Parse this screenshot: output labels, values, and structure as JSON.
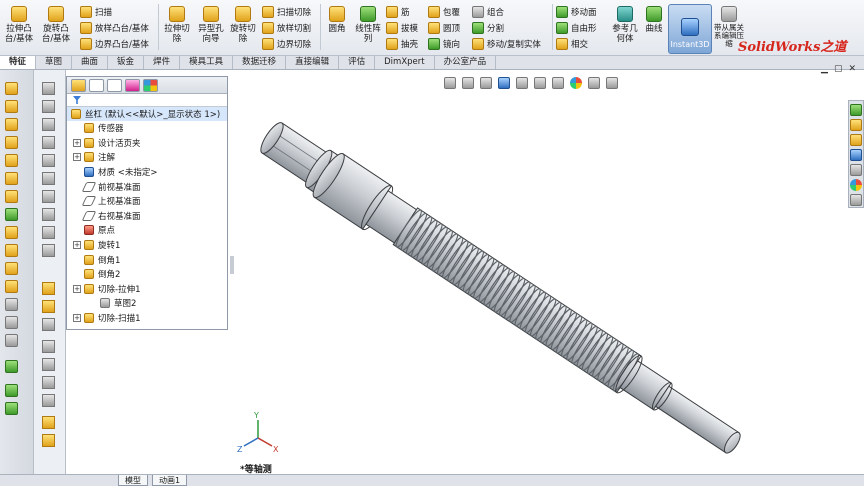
{
  "ribbon": {
    "features": [
      {
        "label": "拉伸凸台/基体",
        "icon": "extrude-boss-icon"
      },
      {
        "label": "旋转凸台/基体",
        "icon": "revolve-boss-icon"
      }
    ],
    "sweeps": [
      {
        "label": "扫描",
        "icon": "sweep-icon"
      },
      {
        "label": "放样凸台/基体",
        "icon": "loft-icon"
      },
      {
        "label": "边界凸台/基体",
        "icon": "boundary-boss-icon"
      }
    ],
    "cuts": [
      {
        "label": "拉伸切除",
        "icon": "extrude-cut-icon"
      },
      {
        "label": "异型孔向导",
        "icon": "hole-wizard-icon"
      },
      {
        "label": "旋转切除",
        "icon": "revolve-cut-icon"
      }
    ],
    "cut_small": [
      {
        "label": "扫描切除",
        "icon": "sweep-cut-icon"
      },
      {
        "label": "放样切割",
        "icon": "loft-cut-icon"
      },
      {
        "label": "边界切除",
        "icon": "boundary-cut-icon"
      }
    ],
    "fillet": {
      "label": "圆角",
      "icon": "fillet-icon"
    },
    "pattern": {
      "label": "线性阵列",
      "icon": "linear-pattern-icon"
    },
    "col_a": [
      {
        "label": "筋",
        "icon": "rib-icon"
      },
      {
        "label": "拔模",
        "icon": "draft-icon"
      },
      {
        "label": "抽壳",
        "icon": "shell-icon"
      }
    ],
    "col_b": [
      {
        "label": "包覆",
        "icon": "wrap-icon"
      },
      {
        "label": "圆顶",
        "icon": "dome-icon"
      },
      {
        "label": "镜向",
        "icon": "mirror-icon"
      }
    ],
    "col_c": [
      {
        "label": "组合",
        "icon": "combine-icon"
      },
      {
        "label": "分割",
        "icon": "split-icon"
      },
      {
        "label": "移动/复制实体",
        "icon": "move-copy-icon"
      }
    ],
    "col_d": [
      {
        "label": "移动面",
        "icon": "move-face-icon"
      },
      {
        "label": "自由形",
        "icon": "freeform-icon"
      },
      {
        "label": "相交",
        "icon": "intersect-icon"
      }
    ],
    "refgeo": {
      "label": "参考几何体",
      "icon": "reference-geometry-icon"
    },
    "curves": {
      "label": "曲线",
      "icon": "curves-icon"
    },
    "instant3d": {
      "label": "Instant3D",
      "icon": "instant3d-icon"
    },
    "assembly": {
      "label": "带从属关系编辑压缩",
      "icon": "assembly-icon"
    },
    "brand": "SolidWorks之道"
  },
  "tabs": [
    "特征",
    "草图",
    "曲面",
    "钣金",
    "焊件",
    "模具工具",
    "数据迁移",
    "直接编辑",
    "评估",
    "DimXpert",
    "办公室产品"
  ],
  "tree": {
    "root": "丝杠 (默认<<默认>_显示状态 1>)",
    "nodes": [
      {
        "label": "传感器",
        "exp": false,
        "indent": 0,
        "icon": "sensor-icon"
      },
      {
        "label": "设计活页夹",
        "exp": true,
        "indent": 0,
        "icon": "design-binder-icon"
      },
      {
        "label": "注解",
        "exp": true,
        "indent": 0,
        "icon": "annotations-icon"
      },
      {
        "label": "材质 <未指定>",
        "exp": false,
        "indent": 0,
        "icon": "material-icon"
      },
      {
        "label": "前视基准面",
        "exp": false,
        "indent": 0,
        "icon": "plane-icon"
      },
      {
        "label": "上视基准面",
        "exp": false,
        "indent": 0,
        "icon": "plane-icon"
      },
      {
        "label": "右视基准面",
        "exp": false,
        "indent": 0,
        "icon": "plane-icon"
      },
      {
        "label": "原点",
        "exp": false,
        "indent": 0,
        "icon": "origin-icon"
      },
      {
        "label": "旋转1",
        "exp": true,
        "indent": 0,
        "icon": "revolve-feature-icon"
      },
      {
        "label": "倒角1",
        "exp": false,
        "indent": 0,
        "icon": "chamfer-icon"
      },
      {
        "label": "倒角2",
        "exp": false,
        "indent": 0,
        "icon": "chamfer-icon"
      },
      {
        "label": "切除-拉伸1",
        "exp": true,
        "indent": 0,
        "icon": "cut-extrude-feature-icon"
      },
      {
        "label": "草图2",
        "exp": false,
        "indent": 1,
        "icon": "sketch-icon"
      },
      {
        "label": "切除-扫描1",
        "exp": true,
        "indent": 0,
        "icon": "cut-sweep-feature-icon"
      }
    ]
  },
  "viewport": {
    "view_name": "*等轴测",
    "triad": {
      "x": "X",
      "y": "Y",
      "z": "Z"
    }
  },
  "status_tabs": [
    "模型",
    "动画1"
  ],
  "colors": {
    "accent": "#3b7dd8",
    "brand_red": "#d6261c",
    "part_body": "#c9cdd2"
  }
}
